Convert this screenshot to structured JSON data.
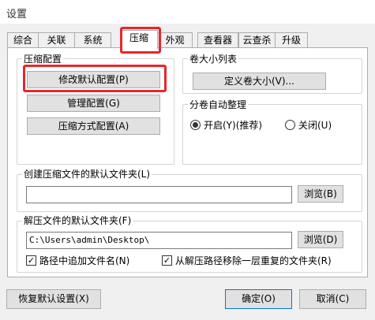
{
  "window": {
    "title": "设置"
  },
  "tabs": [
    {
      "label": "综合"
    },
    {
      "label": "关联"
    },
    {
      "label": "系统"
    },
    {
      "label": "压缩"
    },
    {
      "label": "外观"
    },
    {
      "label": "查看器"
    },
    {
      "label": "云查杀"
    },
    {
      "label": "升级"
    }
  ],
  "compress_config": {
    "title": "压缩配置",
    "modify_label": "修改默认配置(P)",
    "manage_label": "管理配置(G)",
    "method_label": "压缩方式配置(A)"
  },
  "volume_list": {
    "title": "卷大小列表",
    "define_label": "定义卷大小(V)..."
  },
  "auto_arrange": {
    "title": "分卷自动整理",
    "on_label": "开启(Y)(推荐)",
    "off_label": "关闭(U)",
    "selected": "on"
  },
  "create_folder": {
    "title": "创建压缩文件的默认文件夹(L)",
    "value": "",
    "browse_label": "浏览(B)"
  },
  "extract_folder": {
    "title": "解压文件的默认文件夹(F)",
    "value": "C:\\Users\\admin\\Desktop\\",
    "browse_label": "浏览(D)",
    "append_name_label": "路径中追加文件名(N)",
    "append_name_checked": true,
    "remove_dup_label": "从解压路径移除一层重复的文件夹(R)",
    "remove_dup_checked": true
  },
  "footer": {
    "restore_label": "恢复默认设置(X)",
    "ok_label": "确定(O)",
    "cancel_label": "取消(C)"
  },
  "colors": {
    "highlight": "#e8262b",
    "accent": "#0078d7"
  }
}
